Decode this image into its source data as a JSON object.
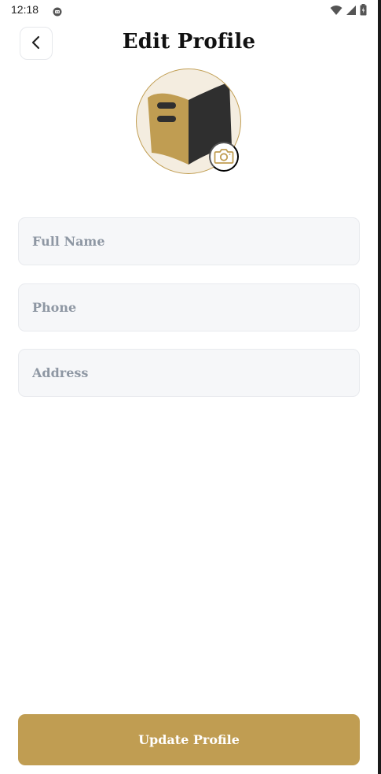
{
  "status_bar": {
    "time": "12:18",
    "icons": [
      "app-notification-icon",
      "wifi-icon",
      "signal-icon",
      "battery-icon"
    ]
  },
  "header": {
    "title": "Edit Profile",
    "back_icon": "chevron-left-icon"
  },
  "avatar": {
    "image": "book-logo",
    "camera_icon": "camera-icon"
  },
  "form": {
    "full_name": {
      "placeholder": "Full Name",
      "value": ""
    },
    "phone": {
      "placeholder": "Phone",
      "value": ""
    },
    "address": {
      "placeholder": "Address",
      "value": ""
    }
  },
  "actions": {
    "update_label": "Update Profile"
  },
  "colors": {
    "accent": "#c09d52",
    "field_background": "#f6f7f9",
    "placeholder": "#8e97a3",
    "title": "#111111"
  }
}
